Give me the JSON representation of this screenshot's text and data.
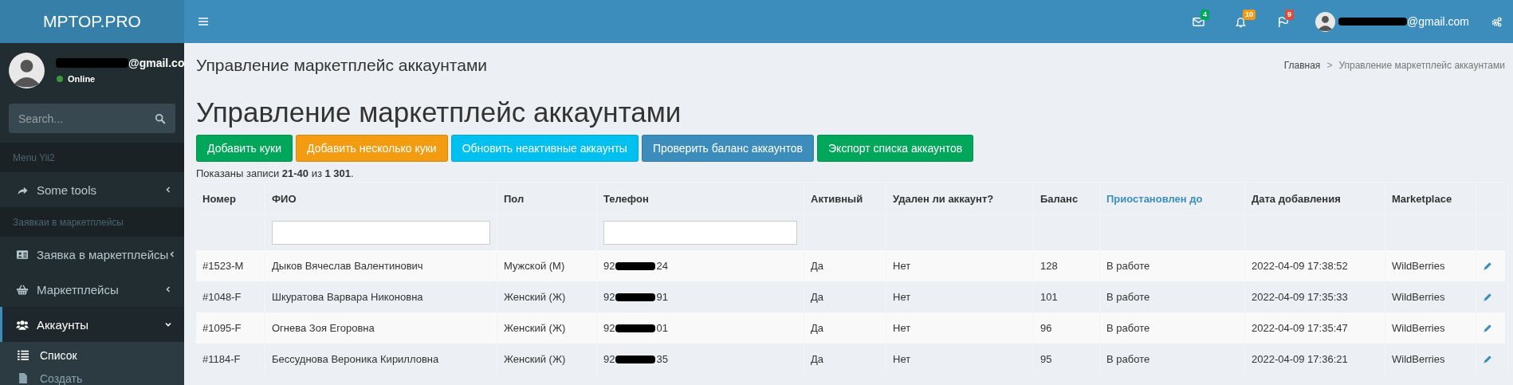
{
  "brand": "MPTOP.PRO",
  "user": {
    "email": "@gmail.co",
    "status": "Online"
  },
  "search": {
    "placeholder": "Search..."
  },
  "menu": [
    {
      "kind": "header",
      "label": "Menu Yii2"
    },
    {
      "kind": "item",
      "label": "Some tools",
      "expanded": false,
      "selected": false
    },
    {
      "kind": "header",
      "label": "Заявкаи в маркетплейсы"
    },
    {
      "kind": "item",
      "label": "Заявка в маркетплейсы",
      "expanded": false,
      "selected": false
    },
    {
      "kind": "item",
      "label": "Маркетплейсы",
      "expanded": false,
      "selected": false
    },
    {
      "kind": "item",
      "label": "Аккаунты",
      "expanded": true,
      "selected": true,
      "children": [
        {
          "label": "Список",
          "selected": true
        },
        {
          "label": "Создать",
          "selected": false
        }
      ]
    }
  ],
  "topbar": {
    "notifications": [
      {
        "count": "4",
        "color": "#00a65a"
      },
      {
        "count": "10",
        "color": "#f39c12"
      },
      {
        "count": "9",
        "color": "#dd4b39"
      }
    ],
    "email": "@gmail.com"
  },
  "page_title": "Управление маркетплейс аккаунтами",
  "breadcrumb": [
    {
      "label": "Главная"
    },
    {
      "label": "Управление маркетплейс аккаунтами"
    }
  ],
  "breadcrumb_separator": ">",
  "heading": "Управление маркетплейс аккаунтами",
  "buttons": [
    {
      "label": "Добавить куки",
      "color": "#00a65a"
    },
    {
      "label": "Добавить несколько куки",
      "color": "#f39c12"
    },
    {
      "label": "Обновить неактивные аккаунты",
      "color": "#00c0ef"
    },
    {
      "label": "Проверить баланс аккаунтов",
      "color": "#3c8dbc"
    },
    {
      "label": "Экспорт списка аккаунтов",
      "color": "#00a65a"
    }
  ],
  "summary": "Показаны записи **21-40** из **1 301**.",
  "table": {
    "columns": [
      {
        "label": "Номер",
        "link": false,
        "filter": false
      },
      {
        "label": "ФИО",
        "link": false,
        "filter": true
      },
      {
        "label": "Пол",
        "link": false,
        "filter": false
      },
      {
        "label": "Телефон",
        "link": false,
        "filter": true
      },
      {
        "label": "Активный",
        "link": false,
        "filter": false
      },
      {
        "label": "Удален ли аккаунт?",
        "link": false,
        "filter": false
      },
      {
        "label": "Баланс",
        "link": false,
        "filter": false
      },
      {
        "label": "Приостановлен до",
        "link": true,
        "filter": false
      },
      {
        "label": "Дата добавления",
        "link": false,
        "filter": false
      },
      {
        "label": "Marketplace",
        "link": false,
        "filter": false
      }
    ],
    "rows": [
      {
        "number": "#1523-M",
        "name": "Дыков Вячеслав Валентинович",
        "gender": "Мужской (М)",
        "phone_start": "92",
        "phone_end": "24",
        "active": "Да",
        "deleted": "Нет",
        "balance": "128",
        "paused_until": "В работе",
        "added": "2022-04-09 17:38:52",
        "marketplace": "WildBerries"
      },
      {
        "number": "#1048-F",
        "name": "Шкуратова Варвара Никоновна",
        "gender": "Женский (Ж)",
        "phone_start": "92",
        "phone_end": "91",
        "active": "Да",
        "deleted": "Нет",
        "balance": "101",
        "paused_until": "В работе",
        "added": "2022-04-09 17:35:33",
        "marketplace": "WildBerries"
      },
      {
        "number": "#1095-F",
        "name": "Огнева Зоя Егоровна",
        "gender": "Женский (Ж)",
        "phone_start": "92",
        "phone_end": "01",
        "active": "Да",
        "deleted": "Нет",
        "balance": "96",
        "paused_until": "В работе",
        "added": "2022-04-09 17:35:47",
        "marketplace": "WildBerries"
      },
      {
        "number": "#1184-F",
        "name": "Бессуднова Вероника Кирилловна",
        "gender": "Женский (Ж)",
        "phone_start": "92",
        "phone_end": "35",
        "active": "Да",
        "deleted": "Нет",
        "balance": "95",
        "paused_until": "В работе",
        "added": "2022-04-09 17:36:21",
        "marketplace": "WildBerries"
      }
    ]
  }
}
